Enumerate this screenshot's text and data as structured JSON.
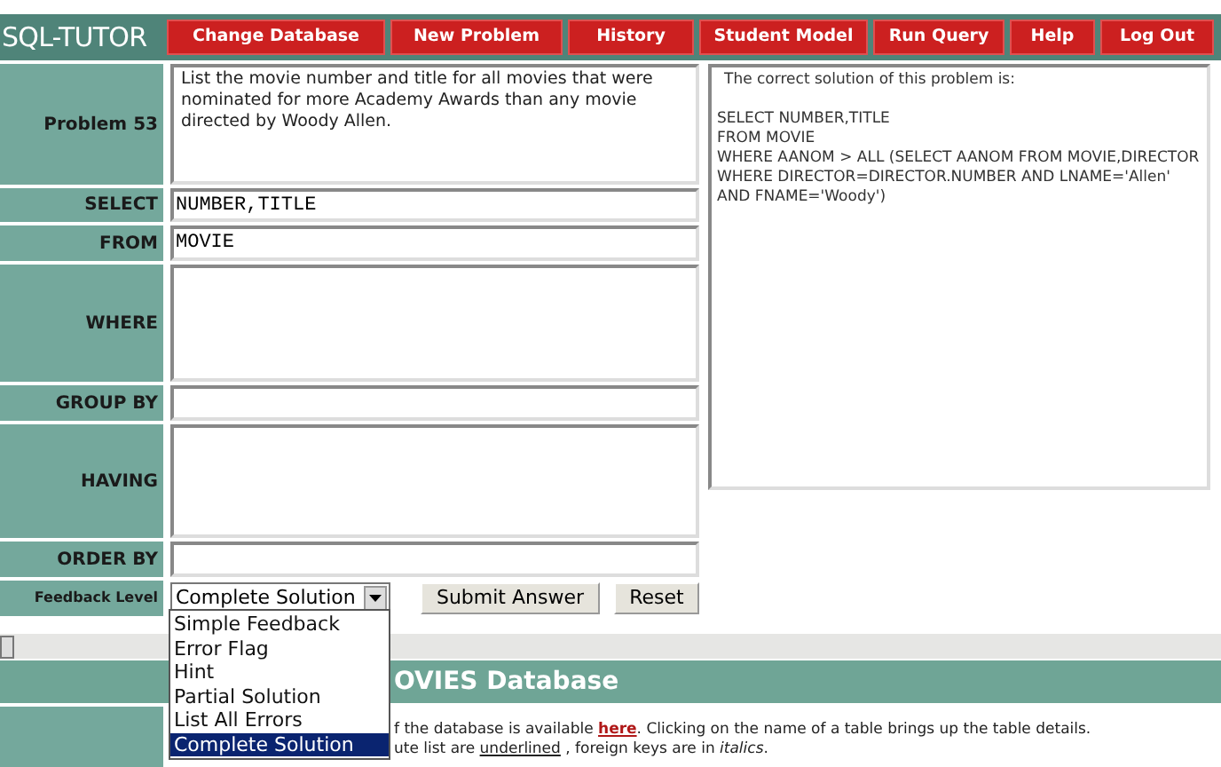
{
  "logo": "SQL-TUTOR",
  "nav": [
    "Change Database",
    "New Problem",
    "History",
    "Student Model",
    "Run Query",
    "Help",
    "Log Out"
  ],
  "problem": {
    "label": "Problem 53",
    "text": "List the movie number and title for all movies that were nominated for more Academy Awards than any movie directed by Woody Allen."
  },
  "clauses": [
    {
      "label": "SELECT",
      "value": "NUMBER,TITLE",
      "kind": "line"
    },
    {
      "label": "FROM",
      "value": "MOVIE",
      "kind": "line"
    },
    {
      "label": "WHERE",
      "kind": "area"
    },
    {
      "label": "GROUP BY",
      "kind": "line"
    },
    {
      "label": "HAVING",
      "kind": "area"
    },
    {
      "label": "ORDER BY",
      "kind": "line"
    }
  ],
  "solution": {
    "intro": "The correct solution of this problem is:",
    "lines": [
      "SELECT NUMBER,TITLE",
      "FROM MOVIE",
      "WHERE AANOM > ALL (SELECT AANOM FROM MOVIE,DIRECTOR WHERE DIRECTOR=DIRECTOR.NUMBER AND LNAME='Allen' AND FNAME='Woody')"
    ]
  },
  "feedback": {
    "label": "Feedback Level",
    "value": "Complete Solution",
    "expanded": true,
    "options": [
      {
        "label": "Simple Feedback",
        "selected": false
      },
      {
        "label": "Error Flag",
        "selected": false
      },
      {
        "label": "Hint",
        "selected": false
      },
      {
        "label": "Partial Solution",
        "selected": false
      },
      {
        "label": "List All Errors",
        "selected": false
      },
      {
        "label": "Complete Solution",
        "selected": true
      }
    ]
  },
  "buttons": [
    "Submit Answer",
    "Reset"
  ],
  "database": {
    "heading": "OVIES Database",
    "line_1": {
      "before": "f the database is available ",
      "link": "here",
      "after": ". Clicking on the name of a table brings up the table details."
    },
    "line_2": {
      "before": "ute list are ",
      "underlined": "underlined",
      "after": " , foreign keys are in *italics*."
    }
  }
}
